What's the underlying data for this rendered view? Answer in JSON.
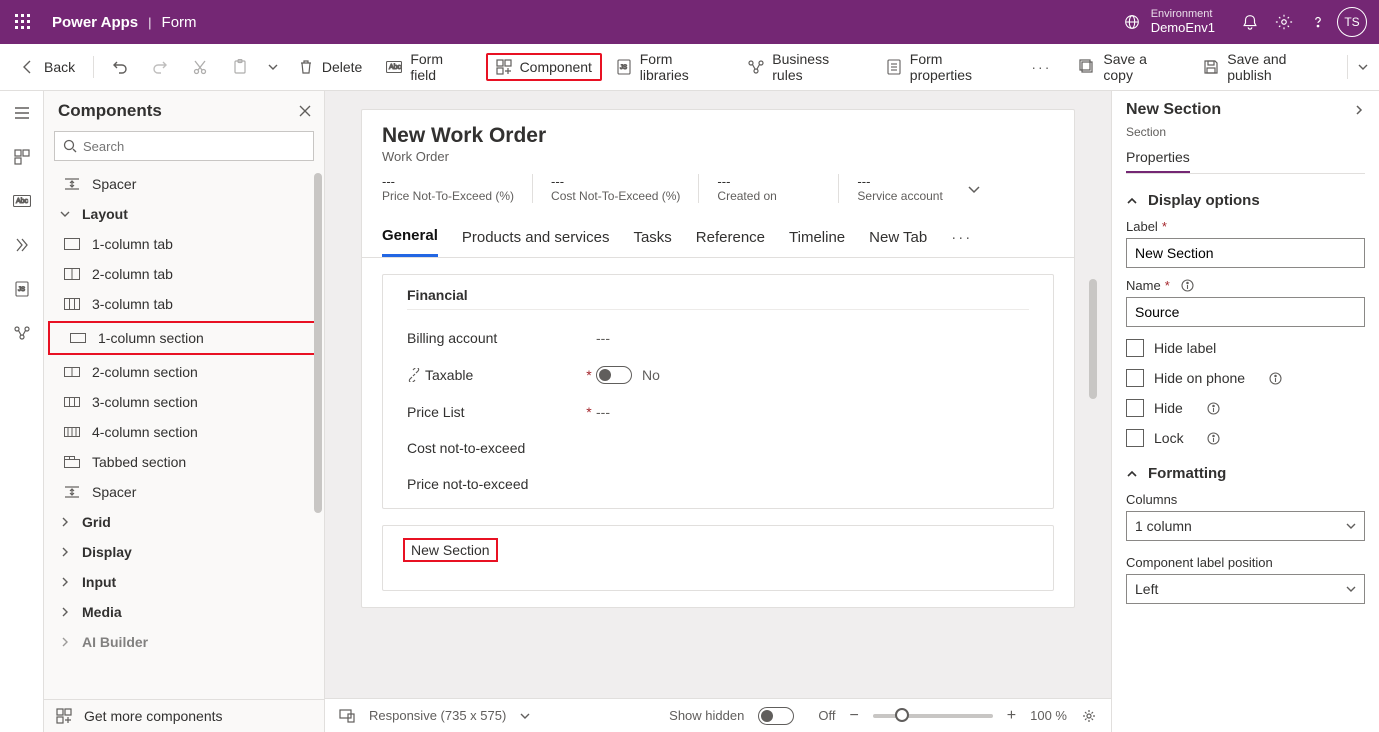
{
  "titlebar": {
    "brand": "Power Apps",
    "sub": "Form",
    "env_label": "Environment",
    "env_value": "DemoEnv1",
    "avatar": "TS"
  },
  "cmdbar": {
    "back": "Back",
    "delete": "Delete",
    "form_field": "Form field",
    "component": "Component",
    "form_libraries": "Form libraries",
    "business_rules": "Business rules",
    "form_properties": "Form properties",
    "save_copy": "Save a copy",
    "save_publish": "Save and publish"
  },
  "left": {
    "title": "Components",
    "search_placeholder": "Search",
    "spacer": "Spacer",
    "layout": "Layout",
    "items": {
      "col1tab": "1-column tab",
      "col2tab": "2-column tab",
      "col3tab": "3-column tab",
      "col1sec": "1-column section",
      "col2sec": "2-column section",
      "col3sec": "3-column section",
      "col4sec": "4-column section",
      "tabbed": "Tabbed section",
      "spacer2": "Spacer"
    },
    "cats": {
      "grid": "Grid",
      "display": "Display",
      "input": "Input",
      "media": "Media",
      "ai": "AI Builder"
    },
    "footer": "Get more components"
  },
  "canvas": {
    "title": "New Work Order",
    "subtitle": "Work Order",
    "header_fields": [
      {
        "val": "---",
        "lab": "Price Not-To-Exceed (%)"
      },
      {
        "val": "---",
        "lab": "Cost Not-To-Exceed (%)"
      },
      {
        "val": "---",
        "lab": "Created on"
      },
      {
        "val": "---",
        "lab": "Service account"
      }
    ],
    "tabs": [
      "General",
      "Products and services",
      "Tasks",
      "Reference",
      "Timeline",
      "New Tab"
    ],
    "section1_title": "Financial",
    "fields": {
      "billing": {
        "label": "Billing account",
        "val": "---"
      },
      "taxable": {
        "label": "Taxable",
        "val": "No"
      },
      "pricelist": {
        "label": "Price List",
        "val": "---"
      },
      "costnte": {
        "label": "Cost not-to-exceed"
      },
      "pricente": {
        "label": "Price not-to-exceed"
      }
    },
    "new_section": "New Section"
  },
  "status": {
    "responsive": "Responsive (735 x 575)",
    "show_hidden": "Show hidden",
    "off": "Off",
    "zoom": "100 %"
  },
  "right": {
    "title": "New Section",
    "sub": "Section",
    "tab": "Properties",
    "display_options": "Display options",
    "label_lab": "Label",
    "label_val": "New Section",
    "name_lab": "Name",
    "name_val": "Source",
    "hide_label": "Hide label",
    "hide_phone": "Hide on phone",
    "hide": "Hide",
    "lock": "Lock",
    "formatting": "Formatting",
    "columns_lab": "Columns",
    "columns_val": "1 column",
    "clp_lab": "Component label position",
    "clp_val": "Left"
  }
}
